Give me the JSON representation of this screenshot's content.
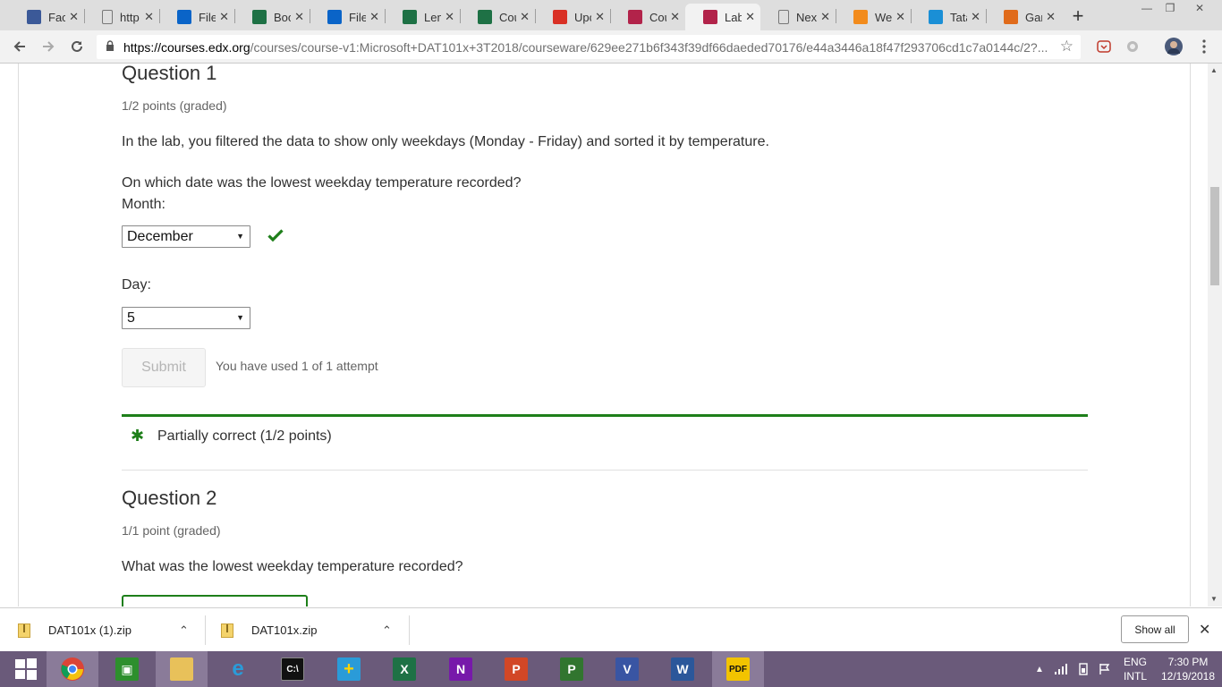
{
  "browser": {
    "tabs": [
      {
        "label": "Faco",
        "favicon": "facebook-icon",
        "color": "#3b5998",
        "active": false
      },
      {
        "label": "http",
        "favicon": "page-icon",
        "color": "#777777",
        "active": false
      },
      {
        "label": "Files",
        "favicon": "onedrive-icon",
        "color": "#0a64c8",
        "active": false
      },
      {
        "label": "Boo",
        "favicon": "excel-icon",
        "color": "#1e7145",
        "active": false
      },
      {
        "label": "Files",
        "favicon": "onedrive-icon",
        "color": "#0a64c8",
        "active": false
      },
      {
        "label": "Lem",
        "favicon": "excel-icon",
        "color": "#1e7145",
        "active": false
      },
      {
        "label": "Cou",
        "favicon": "forms-icon",
        "color": "#1e7145",
        "active": false
      },
      {
        "label": "Upc",
        "favicon": "gmail-icon",
        "color": "#d93025",
        "active": false
      },
      {
        "label": "Cou",
        "favicon": "edx-icon",
        "color": "#b2234a",
        "active": false
      },
      {
        "label": "Lab",
        "favicon": "edx-icon",
        "color": "#b2234a",
        "active": true
      },
      {
        "label": "Nex",
        "favicon": "page-icon",
        "color": "#777777",
        "active": false
      },
      {
        "label": "Wel",
        "favicon": "orange-icon",
        "color": "#f28b1c",
        "active": false
      },
      {
        "label": "Tata",
        "favicon": "globe-icon",
        "color": "#1a8fd6",
        "active": false
      },
      {
        "label": "Gar",
        "favicon": "gauge-icon",
        "color": "#e06b1b",
        "active": false
      }
    ],
    "url_host": "https://courses.edx.org",
    "url_path": "/courses/course-v1:Microsoft+DAT101x+3T2018/courseware/629ee271b6f343f39df66daeded70176/e44a3446a18f47f293706cd1c7a0144c/2?..."
  },
  "question1": {
    "title": "Question 1",
    "points": "1/2 points (graded)",
    "intro": "In the lab, you filtered the data to show only weekdays (Monday - Friday) and sorted it by temperature.",
    "prompt": "On which date was the lowest weekday temperature recorded?",
    "month_label": "Month:",
    "month_value": "December",
    "day_label": "Day:",
    "day_value": "5",
    "submit_label": "Submit",
    "attempts_text": "You have used 1 of 1 attempt",
    "feedback": "Partially correct (1/2 points)"
  },
  "question2": {
    "title": "Question 2",
    "points": "1/1 point (graded)",
    "prompt": "What was the lowest weekday temperature recorded?"
  },
  "downloads": {
    "items": [
      {
        "name": "DAT101x (1).zip"
      },
      {
        "name": "DAT101x.zip"
      }
    ],
    "show_all": "Show all"
  },
  "taskbar": {
    "apps": [
      "start",
      "chrome",
      "store",
      "file-explorer",
      "internet-explorer",
      "cmd",
      "app",
      "excel",
      "onenote",
      "powerpoint",
      "project",
      "visio",
      "word",
      "pdf"
    ],
    "lang_line1": "ENG",
    "lang_line2": "INTL",
    "time": "7:30 PM",
    "date": "12/19/2018"
  },
  "colors": {
    "correct_green": "#1e7f1a",
    "taskbar": "#6a5a7a"
  }
}
